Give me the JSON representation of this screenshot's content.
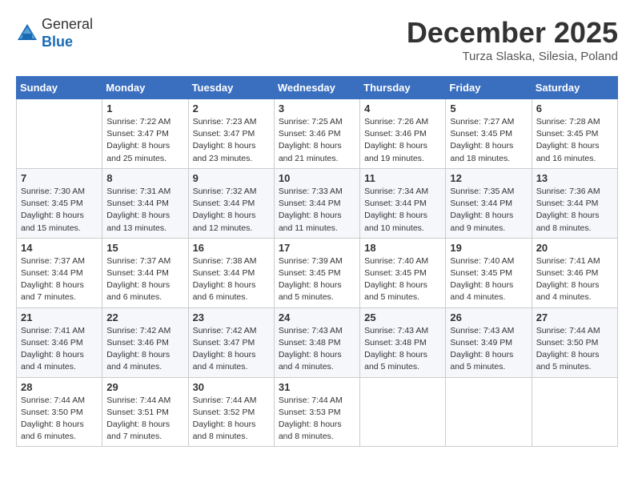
{
  "header": {
    "logo_line1": "General",
    "logo_line2": "Blue",
    "month": "December 2025",
    "location": "Turza Slaska, Silesia, Poland"
  },
  "days_of_week": [
    "Sunday",
    "Monday",
    "Tuesday",
    "Wednesday",
    "Thursday",
    "Friday",
    "Saturday"
  ],
  "weeks": [
    [
      {
        "day": "",
        "info": ""
      },
      {
        "day": "1",
        "info": "Sunrise: 7:22 AM\nSunset: 3:47 PM\nDaylight: 8 hours\nand 25 minutes."
      },
      {
        "day": "2",
        "info": "Sunrise: 7:23 AM\nSunset: 3:47 PM\nDaylight: 8 hours\nand 23 minutes."
      },
      {
        "day": "3",
        "info": "Sunrise: 7:25 AM\nSunset: 3:46 PM\nDaylight: 8 hours\nand 21 minutes."
      },
      {
        "day": "4",
        "info": "Sunrise: 7:26 AM\nSunset: 3:46 PM\nDaylight: 8 hours\nand 19 minutes."
      },
      {
        "day": "5",
        "info": "Sunrise: 7:27 AM\nSunset: 3:45 PM\nDaylight: 8 hours\nand 18 minutes."
      },
      {
        "day": "6",
        "info": "Sunrise: 7:28 AM\nSunset: 3:45 PM\nDaylight: 8 hours\nand 16 minutes."
      }
    ],
    [
      {
        "day": "7",
        "info": "Sunrise: 7:30 AM\nSunset: 3:45 PM\nDaylight: 8 hours\nand 15 minutes."
      },
      {
        "day": "8",
        "info": "Sunrise: 7:31 AM\nSunset: 3:44 PM\nDaylight: 8 hours\nand 13 minutes."
      },
      {
        "day": "9",
        "info": "Sunrise: 7:32 AM\nSunset: 3:44 PM\nDaylight: 8 hours\nand 12 minutes."
      },
      {
        "day": "10",
        "info": "Sunrise: 7:33 AM\nSunset: 3:44 PM\nDaylight: 8 hours\nand 11 minutes."
      },
      {
        "day": "11",
        "info": "Sunrise: 7:34 AM\nSunset: 3:44 PM\nDaylight: 8 hours\nand 10 minutes."
      },
      {
        "day": "12",
        "info": "Sunrise: 7:35 AM\nSunset: 3:44 PM\nDaylight: 8 hours\nand 9 minutes."
      },
      {
        "day": "13",
        "info": "Sunrise: 7:36 AM\nSunset: 3:44 PM\nDaylight: 8 hours\nand 8 minutes."
      }
    ],
    [
      {
        "day": "14",
        "info": "Sunrise: 7:37 AM\nSunset: 3:44 PM\nDaylight: 8 hours\nand 7 minutes."
      },
      {
        "day": "15",
        "info": "Sunrise: 7:37 AM\nSunset: 3:44 PM\nDaylight: 8 hours\nand 6 minutes."
      },
      {
        "day": "16",
        "info": "Sunrise: 7:38 AM\nSunset: 3:44 PM\nDaylight: 8 hours\nand 6 minutes."
      },
      {
        "day": "17",
        "info": "Sunrise: 7:39 AM\nSunset: 3:45 PM\nDaylight: 8 hours\nand 5 minutes."
      },
      {
        "day": "18",
        "info": "Sunrise: 7:40 AM\nSunset: 3:45 PM\nDaylight: 8 hours\nand 5 minutes."
      },
      {
        "day": "19",
        "info": "Sunrise: 7:40 AM\nSunset: 3:45 PM\nDaylight: 8 hours\nand 4 minutes."
      },
      {
        "day": "20",
        "info": "Sunrise: 7:41 AM\nSunset: 3:46 PM\nDaylight: 8 hours\nand 4 minutes."
      }
    ],
    [
      {
        "day": "21",
        "info": "Sunrise: 7:41 AM\nSunset: 3:46 PM\nDaylight: 8 hours\nand 4 minutes."
      },
      {
        "day": "22",
        "info": "Sunrise: 7:42 AM\nSunset: 3:46 PM\nDaylight: 8 hours\nand 4 minutes."
      },
      {
        "day": "23",
        "info": "Sunrise: 7:42 AM\nSunset: 3:47 PM\nDaylight: 8 hours\nand 4 minutes."
      },
      {
        "day": "24",
        "info": "Sunrise: 7:43 AM\nSunset: 3:48 PM\nDaylight: 8 hours\nand 4 minutes."
      },
      {
        "day": "25",
        "info": "Sunrise: 7:43 AM\nSunset: 3:48 PM\nDaylight: 8 hours\nand 5 minutes."
      },
      {
        "day": "26",
        "info": "Sunrise: 7:43 AM\nSunset: 3:49 PM\nDaylight: 8 hours\nand 5 minutes."
      },
      {
        "day": "27",
        "info": "Sunrise: 7:44 AM\nSunset: 3:50 PM\nDaylight: 8 hours\nand 5 minutes."
      }
    ],
    [
      {
        "day": "28",
        "info": "Sunrise: 7:44 AM\nSunset: 3:50 PM\nDaylight: 8 hours\nand 6 minutes."
      },
      {
        "day": "29",
        "info": "Sunrise: 7:44 AM\nSunset: 3:51 PM\nDaylight: 8 hours\nand 7 minutes."
      },
      {
        "day": "30",
        "info": "Sunrise: 7:44 AM\nSunset: 3:52 PM\nDaylight: 8 hours\nand 8 minutes."
      },
      {
        "day": "31",
        "info": "Sunrise: 7:44 AM\nSunset: 3:53 PM\nDaylight: 8 hours\nand 8 minutes."
      },
      {
        "day": "",
        "info": ""
      },
      {
        "day": "",
        "info": ""
      },
      {
        "day": "",
        "info": ""
      }
    ]
  ]
}
